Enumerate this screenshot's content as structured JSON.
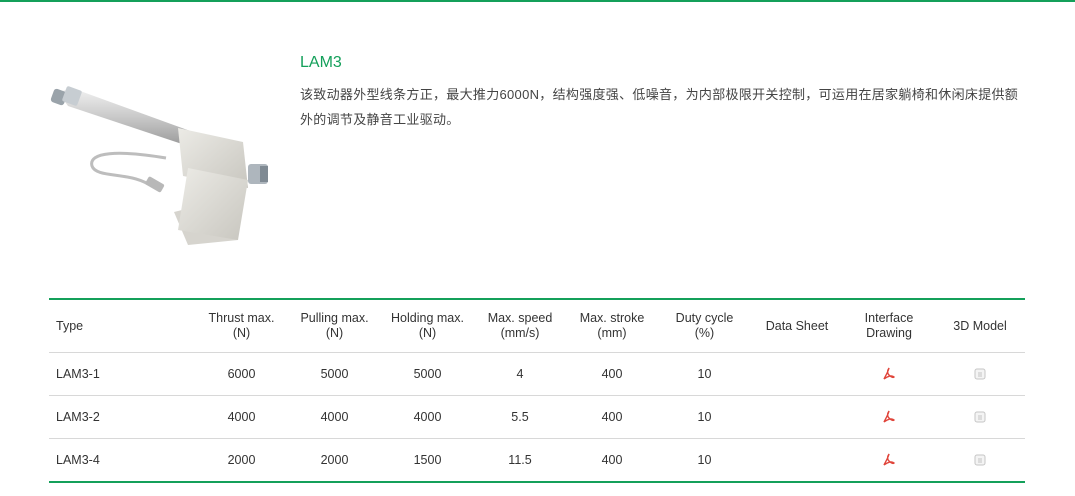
{
  "colors": {
    "accent": "#14a05a",
    "pdf_red": "#e0443a",
    "text": "#333333"
  },
  "product": {
    "title": "LAM3",
    "description": "该致动器外型线条方正，最大推力6000N，结构强度强、低噪音，为内部极限开关控制，可运用在居家躺椅和休闲床提供额外的调节及静音工业驱动。"
  },
  "table": {
    "headers": {
      "type": "Type",
      "thrust": [
        "Thrust max.",
        "(N)"
      ],
      "pulling": [
        "Pulling max.",
        "(N)"
      ],
      "holding": [
        "Holding max.",
        "(N)"
      ],
      "speed": [
        "Max. speed",
        "(mm/s)"
      ],
      "stroke": [
        "Max. stroke",
        "(mm)"
      ],
      "duty": [
        "Duty cycle",
        "(%)"
      ],
      "datasheet": "Data Sheet",
      "interface": [
        "Interface",
        "Drawing"
      ],
      "model": "3D Model"
    },
    "rows": [
      {
        "type": "LAM3-1",
        "thrust": "6000",
        "pulling": "5000",
        "holding": "5000",
        "speed": "4",
        "stroke": "400",
        "duty": "10",
        "interface_icon": "pdf-icon",
        "model_icon": "3d-model-icon"
      },
      {
        "type": "LAM3-2",
        "thrust": "4000",
        "pulling": "4000",
        "holding": "4000",
        "speed": "5.5",
        "stroke": "400",
        "duty": "10",
        "interface_icon": "pdf-icon",
        "model_icon": "3d-model-icon"
      },
      {
        "type": "LAM3-4",
        "thrust": "2000",
        "pulling": "2000",
        "holding": "1500",
        "speed": "11.5",
        "stroke": "400",
        "duty": "10",
        "interface_icon": "pdf-icon",
        "model_icon": "3d-model-icon"
      }
    ]
  }
}
